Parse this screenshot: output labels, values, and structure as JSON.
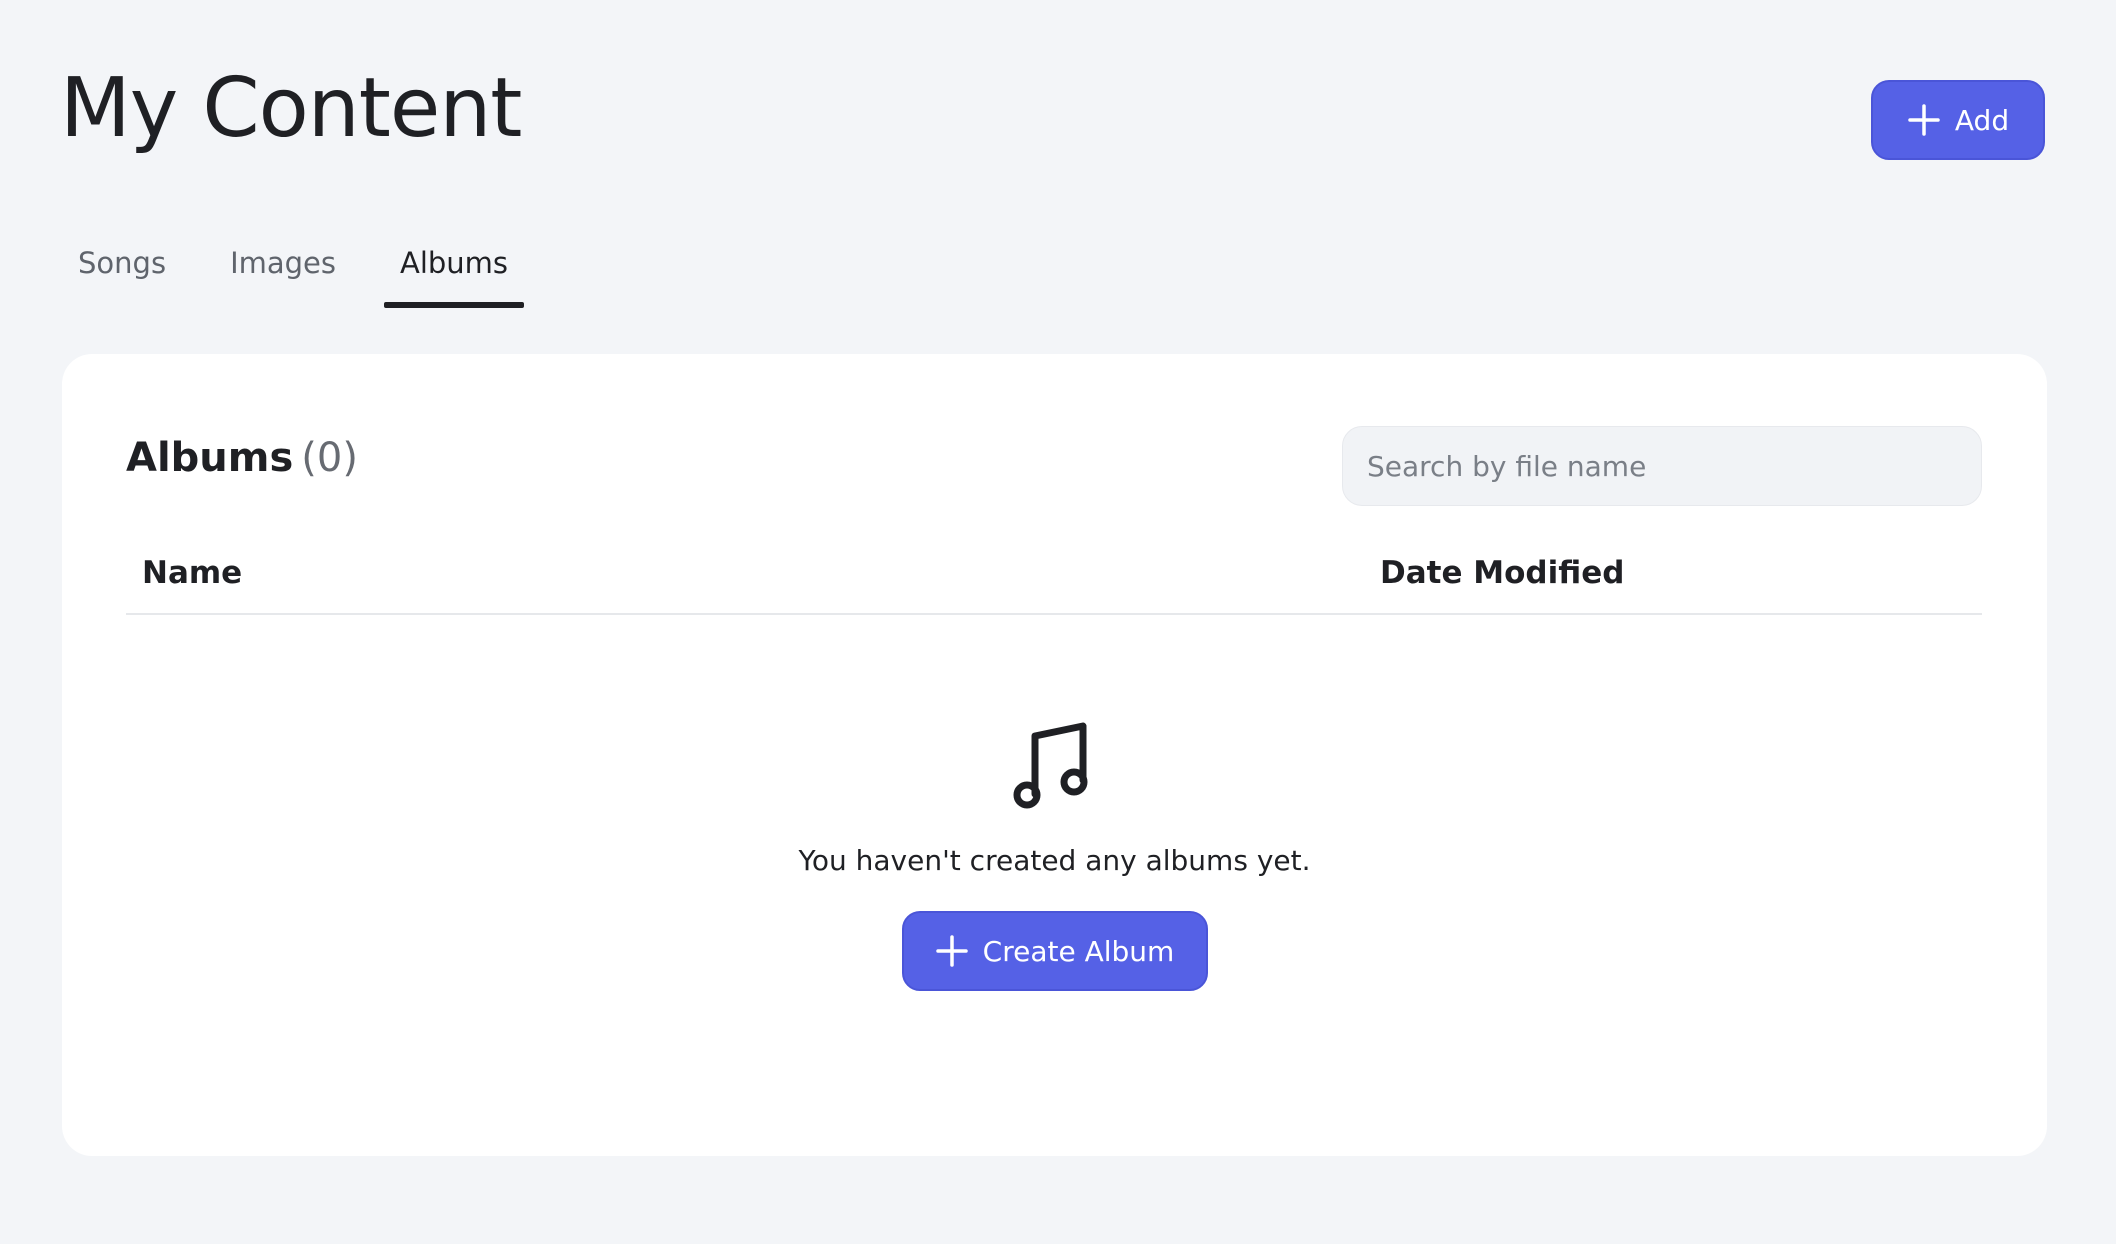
{
  "header": {
    "title": "My Content",
    "add_label": "Add"
  },
  "tabs": [
    {
      "label": "Songs",
      "active": false
    },
    {
      "label": "Images",
      "active": false
    },
    {
      "label": "Albums",
      "active": true
    }
  ],
  "albums_panel": {
    "title": "Albums",
    "count": "(0)",
    "search_placeholder": "Search by file name",
    "columns": [
      "Name",
      "Date Modified"
    ],
    "empty_icon": "music-note-icon",
    "empty_message": "You haven't created any albums yet.",
    "create_label": "Create Album"
  },
  "colors": {
    "accent": "#5561e6",
    "background": "#f3f5f8",
    "card": "#ffffff",
    "text": "#1f2024"
  }
}
